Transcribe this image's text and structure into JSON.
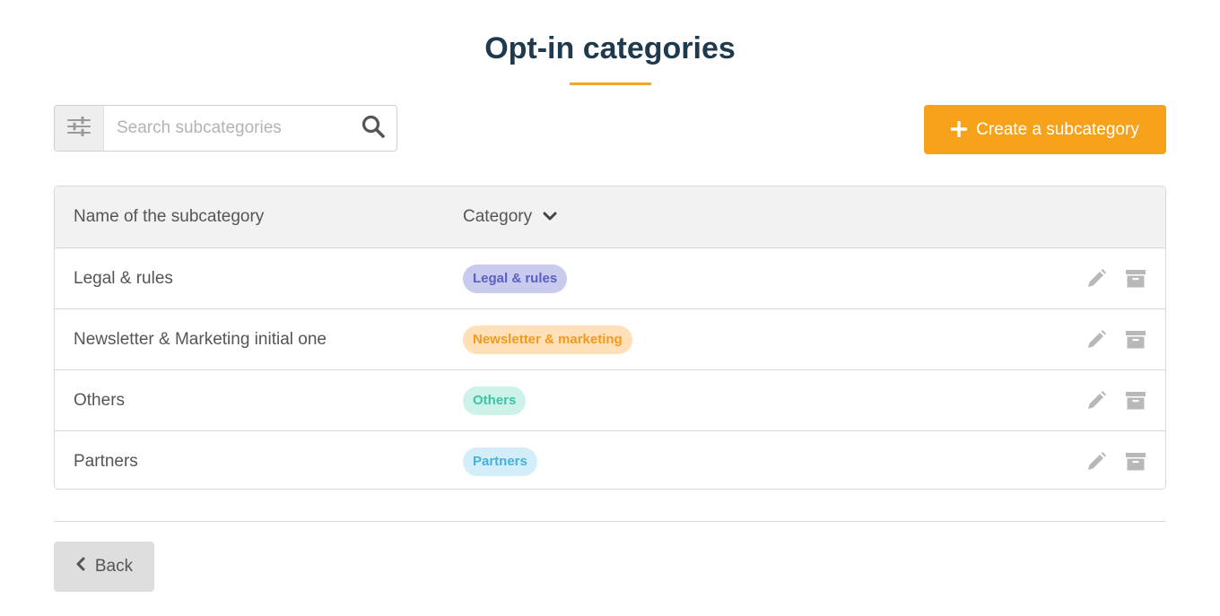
{
  "page": {
    "title": "Opt-in categories",
    "accent_color": "#f5a623",
    "title_color": "#1f3a4d"
  },
  "toolbar": {
    "filter_icon": "sliders-icon",
    "search_placeholder": "Search subcategories",
    "search_value": "",
    "search_icon": "magnifier-icon",
    "create_label": "Create a subcategory",
    "create_icon": "plus-icon",
    "create_color": "#f7a21b"
  },
  "table": {
    "columns": {
      "name": "Name of the subcategory",
      "category": "Category",
      "category_sort_icon": "chevron-down-icon"
    },
    "rows": [
      {
        "name": "Legal & rules",
        "category": "Legal & rules",
        "badge_bg": "#c9cbee",
        "badge_color": "#5a5fc4"
      },
      {
        "name": "Newsletter & Marketing initial one",
        "category": "Newsletter & marketing",
        "badge_bg": "#ffe0b8",
        "badge_color": "#f39a1e"
      },
      {
        "name": "Others",
        "category": "Others",
        "badge_bg": "#cdf2ea",
        "badge_color": "#3cc4a6"
      },
      {
        "name": "Partners",
        "category": "Partners",
        "badge_bg": "#d4eef9",
        "badge_color": "#47b0dc"
      }
    ],
    "row_actions": [
      "pencil-icon",
      "archive-icon"
    ]
  },
  "footer": {
    "back_label": "Back",
    "back_icon": "chevron-left-icon"
  }
}
